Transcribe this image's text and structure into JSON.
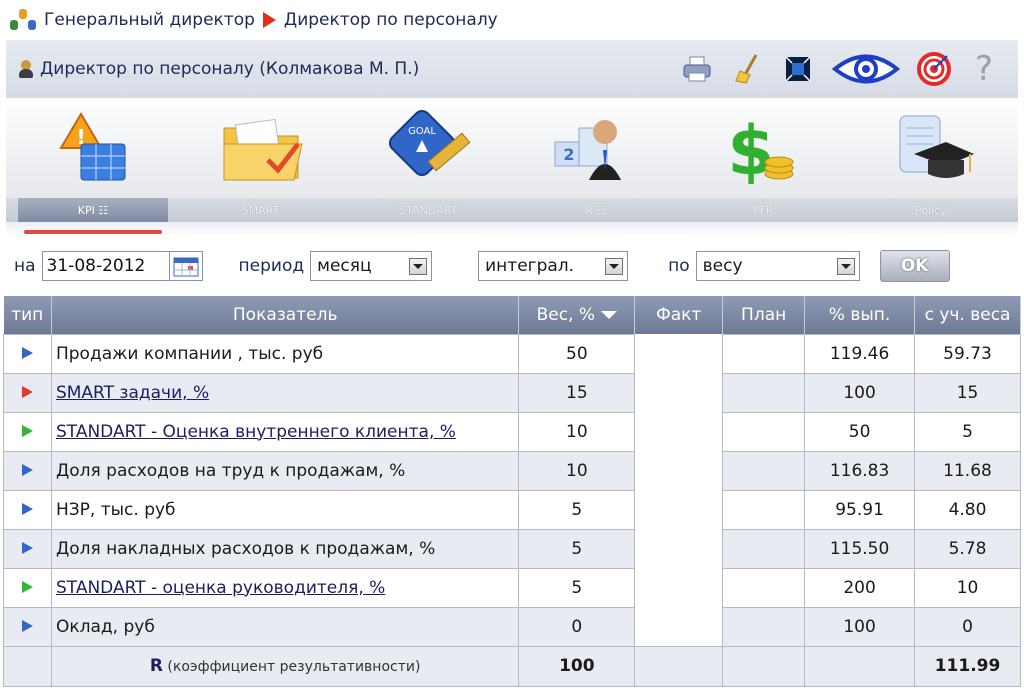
{
  "breadcrumb": {
    "parent": "Генеральный директор",
    "current": "Директор по персоналу"
  },
  "header": {
    "title": "Директор по персоналу  (Колмакова М. П.)"
  },
  "toolbar": {
    "icons": [
      "printer-icon",
      "broom-icon",
      "fullscreen-icon",
      "eye-icon",
      "target-icon",
      "help-icon"
    ],
    "help_label": "?"
  },
  "modules": [
    "KPI",
    "SMART",
    "STANDART",
    "R",
    "PFR",
    "Policy"
  ],
  "tabs": [
    {
      "label": "KPI ☷",
      "active": true
    },
    {
      "label": "SMART",
      "active": false
    },
    {
      "label": "STANDART",
      "active": false
    },
    {
      "label": "R ☷",
      "active": false
    },
    {
      "label": "PFR",
      "active": false
    },
    {
      "label": "Policy",
      "active": false
    }
  ],
  "filters": {
    "date_label": "на",
    "date_value": "31-08-2012",
    "period_label": "период",
    "period_value": "месяц",
    "mode_value": "интеграл.",
    "sort_label": "по",
    "sort_value": "весу",
    "ok_label": "OK"
  },
  "table": {
    "headers": [
      "тип",
      "Показатель",
      "Вес, %",
      "Факт",
      "План",
      "% вып.",
      "с уч. веса"
    ],
    "rows": [
      {
        "type_color": "#3466c8",
        "name": "Продажи компании , тыс. руб",
        "link": false,
        "weight": "50",
        "fact": "",
        "plan": "",
        "pct": "119.46",
        "weighted": "59.73"
      },
      {
        "type_color": "#e23b2e",
        "name": "SMART задачи, %",
        "link": true,
        "weight": "15",
        "fact": "",
        "plan": "",
        "pct": "100",
        "weighted": "15"
      },
      {
        "type_color": "#35b537",
        "name": "STANDART - Оценка внутреннего клиента, %",
        "link": true,
        "weight": "10",
        "fact": "",
        "plan": "",
        "pct": "50",
        "weighted": "5"
      },
      {
        "type_color": "#3466c8",
        "name": "Доля расходов на труд к продажам, %",
        "link": false,
        "weight": "10",
        "fact": "",
        "plan": "",
        "pct": "116.83",
        "weighted": "11.68"
      },
      {
        "type_color": "#3466c8",
        "name": "НЗР, тыс. руб",
        "link": false,
        "weight": "5",
        "fact": "",
        "plan": "",
        "pct": "95.91",
        "weighted": "4.80"
      },
      {
        "type_color": "#3466c8",
        "name": "Доля накладных расходов к продажам, %",
        "link": false,
        "weight": "5",
        "fact": "",
        "plan": "",
        "pct": "115.50",
        "weighted": "5.78"
      },
      {
        "type_color": "#35b537",
        "name": "STANDART - оценка руководителя, %",
        "link": true,
        "weight": "5",
        "fact": "",
        "plan": "",
        "pct": "200",
        "weighted": "10"
      },
      {
        "type_color": "#3466c8",
        "name": "Оклад, руб",
        "link": false,
        "weight": "0",
        "fact": "",
        "plan": "",
        "pct": "100",
        "weighted": "0"
      }
    ],
    "total": {
      "label_bold": "R",
      "label_rest": " (коэффициент результативности)",
      "weight": "100",
      "weighted": "111.99"
    }
  },
  "colors": {
    "header_bg": "#7f8aa3",
    "accent_red": "#e4473e",
    "link": "#1b1e5f"
  }
}
